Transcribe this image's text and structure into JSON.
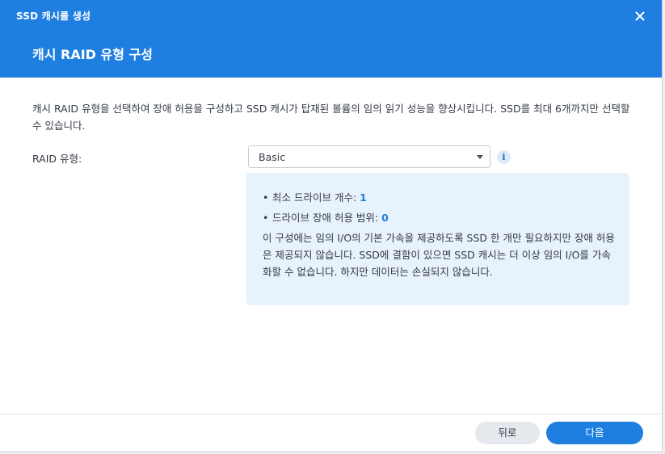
{
  "window": {
    "title": "SSD 캐시를 생성",
    "step_title": "캐시 RAID 유형 구성"
  },
  "body": {
    "description": "캐시 RAID 유형을 선택하여 장애 허용을 구성하고 SSD 캐시가 탑재된 볼륨의 임의 읽기 성능을 향상시킵니다. SSD를 최대 6개까지만 선택할 수 있습니다.",
    "raid_label": "RAID 유형:",
    "raid_selected": "Basic",
    "info_icon_glyph": "i",
    "info": {
      "bullet": "•",
      "min_drives_label": "최소 드라이브 개수:",
      "min_drives_value": "1",
      "fault_tolerance_label": "드라이브 장애 허용 범위:",
      "fault_tolerance_value": "0",
      "explanation": "이 구성에는 임의 I/O의 기본 가속을 제공하도록 SSD 한 개만 필요하지만 장애 허용은 제공되지 않습니다. SSD에 결함이 있으면 SSD 캐시는 더 이상 임의 I/O를 가속화할 수 없습니다. 하지만 데이터는 손실되지 않습니다."
    }
  },
  "footer": {
    "back_label": "뒤로",
    "next_label": "다음"
  },
  "colors": {
    "header": "#1f7fe0",
    "accent": "#1f7fe0",
    "info_box": "#e8f2fc",
    "back_button": "#e5e9ee"
  },
  "icons": {
    "close": "close-icon",
    "dropdown": "chevron-down-icon",
    "info": "info-icon"
  }
}
